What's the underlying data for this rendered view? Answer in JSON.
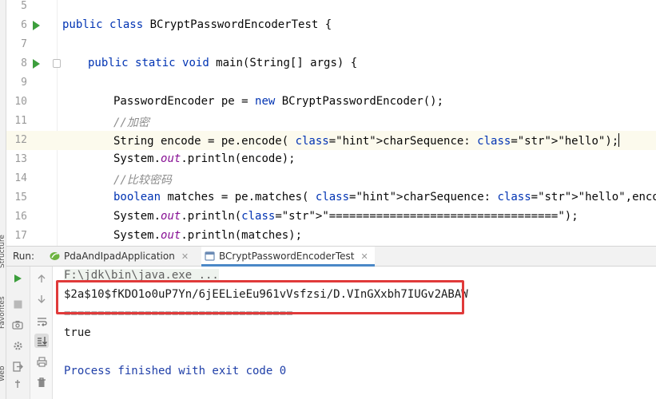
{
  "sidebar": {
    "labels": [
      "Structure",
      "Favorites",
      "Web"
    ]
  },
  "editor": {
    "lines": [
      {
        "num": "5",
        "code": ""
      },
      {
        "num": "6",
        "code": "public class BCryptPasswordEncoderTest {"
      },
      {
        "num": "7",
        "code": ""
      },
      {
        "num": "8",
        "code": "public static void main(String[] args) {"
      },
      {
        "num": "9",
        "code": ""
      },
      {
        "num": "10",
        "code": "PasswordEncoder pe = new BCryptPasswordEncoder();"
      },
      {
        "num": "11",
        "code": "//加密"
      },
      {
        "num": "12",
        "code": "String encode = pe.encode( charSequence: \"hello\");"
      },
      {
        "num": "13",
        "code": "System.out.println(encode);"
      },
      {
        "num": "14",
        "code": "//比较密码"
      },
      {
        "num": "15",
        "code": "boolean matches = pe.matches( charSequence: \"hello\",encode);"
      },
      {
        "num": "16",
        "code": "System.out.println(\"==================================\");"
      },
      {
        "num": "17",
        "code": "System.out.println(matches);"
      }
    ]
  },
  "run": {
    "title": "Run:",
    "tabs": [
      {
        "label": "PdaAndIpadApplication",
        "active": false
      },
      {
        "label": "BCryptPasswordEncoderTest",
        "active": true
      }
    ],
    "close_glyph": "✕"
  },
  "console": {
    "command": "F:\\jdk\\bin\\java.exe ...",
    "hash": "$2a$10$fKDO1o0uP7Yn/6jEELieEu961vVsfzsi/D.VInGXxbh7IUGv2ABAW",
    "separator": "==================================",
    "result": "true",
    "exit": "Process finished with exit code 0"
  },
  "colors": {
    "highlight_border": "#e03a3a",
    "keyword": "#0033b3",
    "string": "#067d17",
    "run_glyph": "#3c9e3c"
  }
}
